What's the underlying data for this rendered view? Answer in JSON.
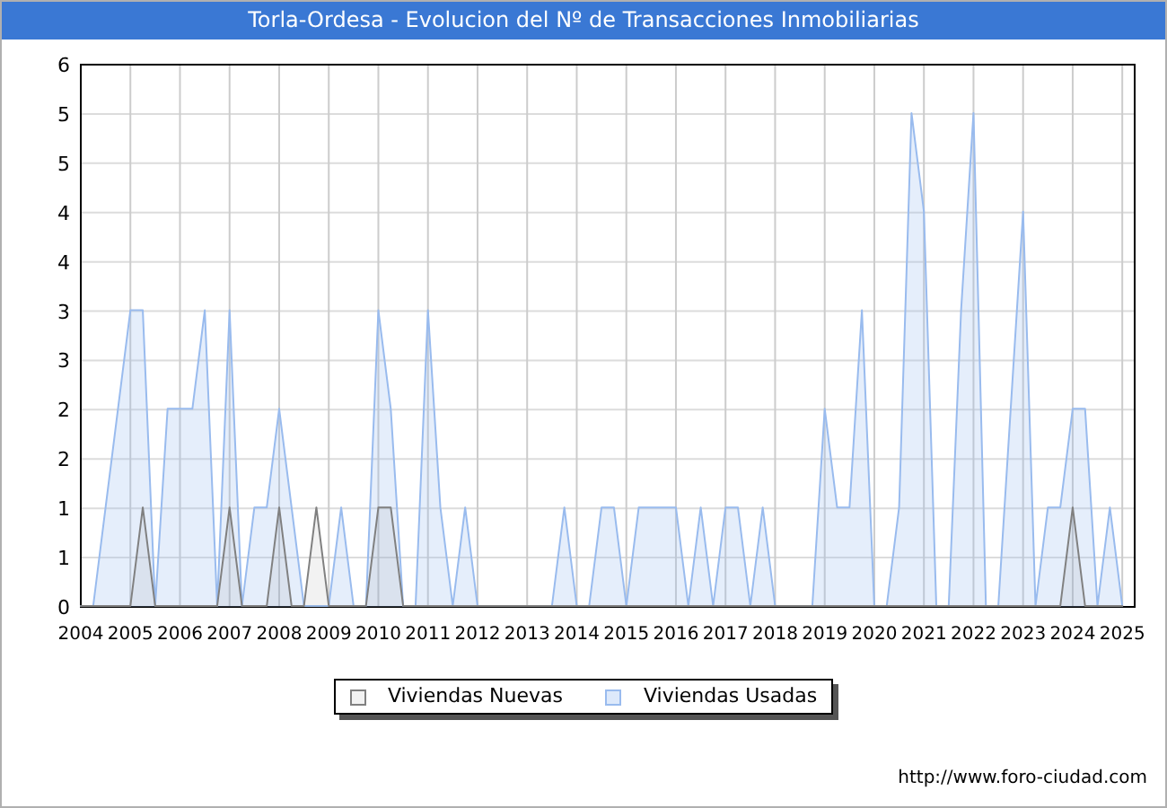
{
  "window": {
    "title": "Torla-Ordesa - Evolucion del Nº de Transacciones Inmobiliarias"
  },
  "chart": {
    "chart_data": {
      "type": "area",
      "x": [
        2004,
        2004.25,
        2004.5,
        2004.75,
        2005,
        2005.25,
        2005.5,
        2005.75,
        2006,
        2006.25,
        2006.5,
        2006.75,
        2007,
        2007.25,
        2007.5,
        2007.75,
        2008,
        2008.25,
        2008.5,
        2008.75,
        2009,
        2009.25,
        2009.5,
        2009.75,
        2010,
        2010.25,
        2010.5,
        2010.75,
        2011,
        2011.25,
        2011.5,
        2011.75,
        2012,
        2012.25,
        2012.5,
        2012.75,
        2013,
        2013.25,
        2013.5,
        2013.75,
        2014,
        2014.25,
        2014.5,
        2014.75,
        2015,
        2015.25,
        2015.5,
        2015.75,
        2016,
        2016.25,
        2016.5,
        2016.75,
        2017,
        2017.25,
        2017.5,
        2017.75,
        2018,
        2018.25,
        2018.5,
        2018.75,
        2019,
        2019.25,
        2019.5,
        2019.75,
        2020,
        2020.25,
        2020.5,
        2020.75,
        2021,
        2021.25,
        2021.5,
        2021.75,
        2022,
        2022.25,
        2022.5,
        2022.75,
        2023,
        2023.25,
        2023.5,
        2023.75,
        2024,
        2024.25,
        2024.5,
        2024.75,
        2025
      ],
      "series": [
        {
          "name": "Viviendas Nuevas",
          "color": "#808080",
          "values": [
            0,
            0,
            0,
            0,
            0,
            1,
            0,
            0,
            0,
            0,
            0,
            0,
            1,
            0,
            0,
            0,
            1,
            0,
            0,
            1,
            0,
            0,
            0,
            0,
            1,
            1,
            0,
            0,
            0,
            0,
            0,
            0,
            0,
            0,
            0,
            0,
            0,
            0,
            0,
            0,
            0,
            0,
            0,
            0,
            0,
            0,
            0,
            0,
            0,
            0,
            0,
            0,
            0,
            0,
            0,
            0,
            0,
            0,
            0,
            0,
            0,
            0,
            0,
            0,
            0,
            0,
            0,
            0,
            0,
            0,
            0,
            0,
            0,
            0,
            0,
            0,
            0,
            0,
            0,
            0,
            1,
            0,
            0,
            0,
            0
          ]
        },
        {
          "name": "Viviendas Usadas",
          "color": "#99bbee",
          "values": [
            0,
            0,
            1,
            2,
            3,
            3,
            0,
            2,
            2,
            2,
            3,
            0,
            3,
            0,
            1,
            1,
            2,
            1,
            0,
            0,
            0,
            1,
            0,
            0,
            3,
            2,
            0,
            0,
            3,
            1,
            0,
            1,
            0,
            0,
            0,
            0,
            0,
            0,
            0,
            1,
            0,
            0,
            1,
            1,
            0,
            1,
            1,
            1,
            1,
            0,
            1,
            0,
            1,
            1,
            0,
            1,
            0,
            0,
            0,
            0,
            2,
            1,
            1,
            3,
            0,
            0,
            1,
            5,
            4,
            0,
            0,
            3,
            5,
            0,
            0,
            2,
            4,
            0,
            1,
            1,
            2,
            2,
            0,
            1,
            0
          ]
        }
      ],
      "grid": true,
      "xlim": [
        2004,
        2025.25
      ],
      "ylim": [
        0,
        5.5
      ],
      "xticks": [
        2004,
        2005,
        2006,
        2007,
        2008,
        2009,
        2010,
        2011,
        2012,
        2013,
        2014,
        2015,
        2016,
        2017,
        2018,
        2019,
        2020,
        2021,
        2022,
        2023,
        2024,
        2025
      ],
      "yticks": [
        {
          "value": 0,
          "label": "0"
        },
        {
          "value": 0.5,
          "label": "1"
        },
        {
          "value": 1,
          "label": "1"
        },
        {
          "value": 1.5,
          "label": "2"
        },
        {
          "value": 2,
          "label": "2"
        },
        {
          "value": 2.5,
          "label": "3"
        },
        {
          "value": 3,
          "label": "3"
        },
        {
          "value": 3.5,
          "label": "4"
        },
        {
          "value": 4,
          "label": "4"
        },
        {
          "value": 4.5,
          "label": "5"
        },
        {
          "value": 5,
          "label": "5"
        },
        {
          "value": 5.5,
          "label": "6"
        }
      ]
    }
  },
  "footer": {
    "url": "http://www.foro-ciudad.com"
  }
}
